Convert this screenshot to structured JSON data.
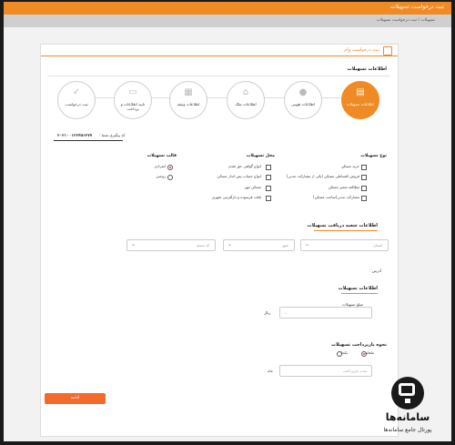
{
  "header": {
    "title": "ثبت درخواست تسهیلات",
    "breadcrumb": "تسهیلات / ثبت درخواست تسهیلات"
  },
  "card": {
    "title": "ثبت درخواست وام",
    "section_title": "اطلاعات تسهیلات"
  },
  "steps": [
    {
      "label": "اطلاعات تسهیلات",
      "icon": "document-icon",
      "active": true
    },
    {
      "label": "اطلاعات هویتی",
      "icon": "user-icon",
      "active": false
    },
    {
      "label": "اطلاعات ملک",
      "icon": "house-icon",
      "active": false
    },
    {
      "label": "اطلاعات وثیقه",
      "icon": "id-card-icon",
      "active": false
    },
    {
      "label": "تایید اطلاعات و پرداخت",
      "icon": "payment-icon",
      "active": false
    },
    {
      "label": "ثبت درخواست",
      "icon": "check-icon",
      "active": false
    }
  ],
  "tracking": {
    "label": "کد پیگیری شما :",
    "value": "۲۰۲۱۰۰۱۲۳۴۵۶۳۷۷"
  },
  "loan_type": {
    "title": "نوع تسهیلات",
    "options": [
      "خرید مسکن",
      "فروش اقساطی مسکن (یکی از مشارکت مدنی)",
      "مطالعه تعمیر مسکن",
      "مشارکت مدنی(ساخت مسکن)"
    ]
  },
  "loan_place": {
    "title": "محل تسهیلات",
    "options": [
      "انواع گواهی حق تقدم",
      "انواع حساب پس انداز مسکن",
      "مسکن مهر",
      "بافت فرسوده و بازآفرینی شهری"
    ]
  },
  "loan_template": {
    "title": "قالب تسهیلات",
    "options": [
      {
        "label": "انفرادی",
        "selected": true
      },
      {
        "label": "زوجین",
        "selected": false
      }
    ]
  },
  "branch": {
    "title": "اطلاعات شعبه دریافت تسهیلات",
    "selects": [
      "استان",
      "شهر",
      "کد شعبه"
    ],
    "address_label": "آدرس :"
  },
  "loan_info": {
    "title": "اطلاعات تسهیلات",
    "amount_label": "مبلغ تسهیلات",
    "amount_unit": "ریال",
    "repay_title": "نحوه بازپرداخت تسهیلات",
    "repay_options": [
      {
        "label": "ماهانه",
        "selected": true
      },
      {
        "label": "یکجا",
        "selected": false
      }
    ],
    "period_placeholder": "مدت بازپرداخت",
    "period_unit": "ماه"
  },
  "submit_label": "ادامه",
  "brand": {
    "name": "سامانه‌ها",
    "subtitle": "پورتال جامع سامانه‌ها"
  }
}
